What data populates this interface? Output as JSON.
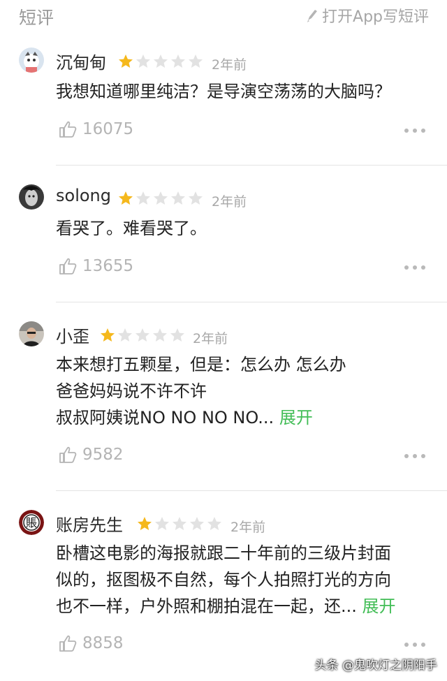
{
  "header": {
    "title": "短评",
    "write_label": "打开App写短评"
  },
  "reviews": [
    {
      "username": "沉甸甸",
      "time": "2年前",
      "lines": [
        "我想知道哪里纯洁？是导演空荡荡的大脑吗？"
      ],
      "expand": "",
      "likes": "16075",
      "rating": 1
    },
    {
      "username": "solong",
      "time": "2年前",
      "lines": [
        "看哭了。难看哭了。"
      ],
      "expand": "",
      "likes": "13655",
      "rating": 1
    },
    {
      "username": "小歪",
      "time": "2年前",
      "lines": [
        "本来想打五颗星，但是：怎么办 怎么办",
        "爸爸妈妈说不许不许",
        "叔叔阿姨说NO NO NO NO..."
      ],
      "expand": "展开",
      "likes": "9582",
      "rating": 1
    },
    {
      "username": "账房先生",
      "time": "2年前",
      "lines": [
        "卧槽这电影的海报就跟二十年前的三级片封面",
        "似的，抠图极不自然，每个人拍照打光的方向",
        "也不一样，户外照和棚拍混在一起，还..."
      ],
      "expand": "展开",
      "likes": "8858",
      "rating": 1
    }
  ],
  "avatar4_glyph": "賬",
  "watermark": "头条 @鬼吹灯之阴阳手",
  "colors": {
    "star_on": "#f5b81c",
    "star_off": "#e2e2e2",
    "expand": "#42bd56"
  },
  "icons": {
    "write": "pencil-icon",
    "like": "thumbs-up-icon",
    "more": "more-dots-icon",
    "star": "star-icon"
  }
}
